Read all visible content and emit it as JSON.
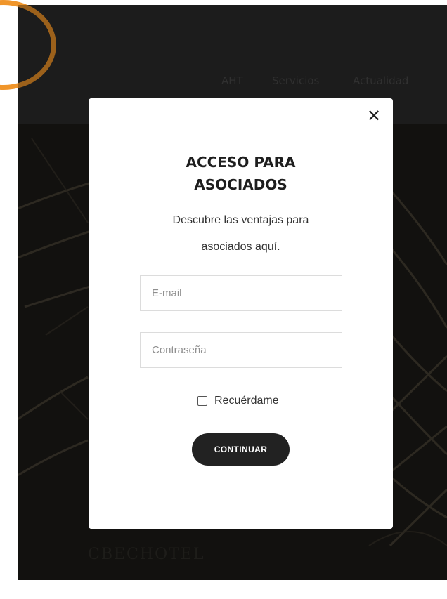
{
  "nav": {
    "items": [
      "AHT",
      "Servicios",
      "Actualidad"
    ]
  },
  "modal": {
    "close_icon": "close-icon",
    "title": "ACCESO PARA ASOCIADOS",
    "title_line1": "ACCESO PARA",
    "title_line2": "ASOCIADOS",
    "subtitle": "Descubre las ventajas para asociados aquí.",
    "email_placeholder": "E-mail",
    "password_placeholder": "Contraseña",
    "remember_label": "Recuérdame",
    "submit_label": "CONTINUAR"
  },
  "colors": {
    "accent_ring": "#f0952a",
    "header_bg": "#2b2b2b",
    "button_bg": "#222222"
  }
}
